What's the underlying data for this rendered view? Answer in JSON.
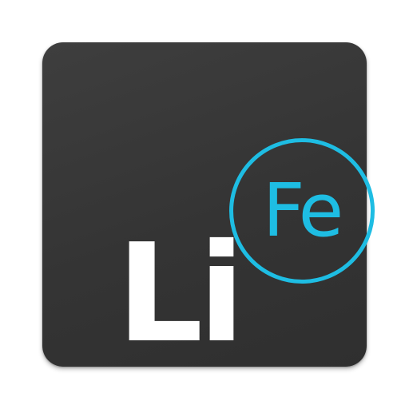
{
  "icon": {
    "li_symbol": "Li",
    "fe_symbol": "Fe",
    "background_color": "#363636",
    "accent_color": "#1ebde3",
    "text_color": "#ffffff"
  }
}
